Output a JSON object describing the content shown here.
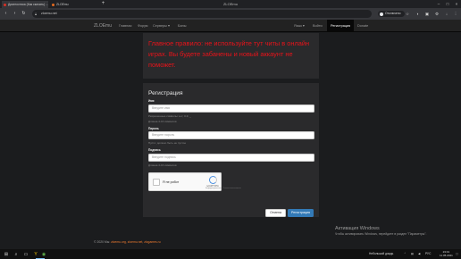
{
  "browser": {
    "tabs": [
      {
        "title": "Диагностика (Как скачать) ...",
        "active": true
      },
      {
        "title": "ZLOEmu",
        "active": false
      }
    ],
    "new_tab_icon": "plus-icon",
    "window_title": "ZLOEmu",
    "address": "zloemu.net",
    "sync_label": "Отключено",
    "nav_icons": [
      "back-arrow-icon",
      "forward-arrow-icon",
      "reload-icon",
      "lock-icon"
    ],
    "extension_icons": [
      "translate-icon",
      "star-icon",
      "extension-icon",
      "menu-icon"
    ]
  },
  "navbar": {
    "brand": "ZLOEmu",
    "links": [
      "Главная",
      "Форум",
      "Серверы ▾",
      "Баны"
    ],
    "right_links": [
      "Язык ▾",
      "Войти",
      "Регистрация",
      "Donate"
    ],
    "active_link": "Регистрация"
  },
  "warning": {
    "text": "Главное правило: не используйте тут читы в онлайн играх. Вы будете забанены и новый аккаунт не поможет.",
    "color": "#e8131a"
  },
  "form": {
    "title": "Регистрация",
    "fields": [
      {
        "label": "Имя",
        "placeholder": "Введите имя",
        "help": [
          "Разрешенные символы: a-z, 0-9, _",
          "Длинна 4-16 символов"
        ]
      },
      {
        "label": "Пароль",
        "placeholder": "Введите пароль",
        "help": [
          "Пусто: должно быть не пустое"
        ]
      },
      {
        "label": "Подпись",
        "placeholder": "Введите подпись",
        "help": [
          "Длинна 4-16 символов"
        ]
      }
    ],
    "captcha": {
      "label": "Я не робот",
      "brand": "reCAPTCHA",
      "links": "Конфиденциальность · Условия использования"
    },
    "cancel_label": "Отмена",
    "submit_label": "Регистрация",
    "accent": "#337ab7"
  },
  "footer": {
    "copyright": "© 2020 Мы:",
    "links": "zloemu.org, zloemu.net, zlogames.ru"
  },
  "watermark": {
    "title": "Активация Windows",
    "subtitle": "Чтобы активировать Windows, перейдите в раздел \"Параметры\"."
  },
  "taskbar": {
    "icons": [
      "windows-start-icon",
      "search-icon",
      "task-view-icon",
      "file-explorer-icon",
      "yandex-browser-icon",
      "chrome-icon"
    ],
    "tray_text": "Небольшой дождь",
    "tray_icons": [
      "chevron-up-icon",
      "network-icon",
      "volume-icon",
      "language-icon"
    ],
    "language": "РУС",
    "time": "23:01",
    "date": "11.05.2021"
  }
}
